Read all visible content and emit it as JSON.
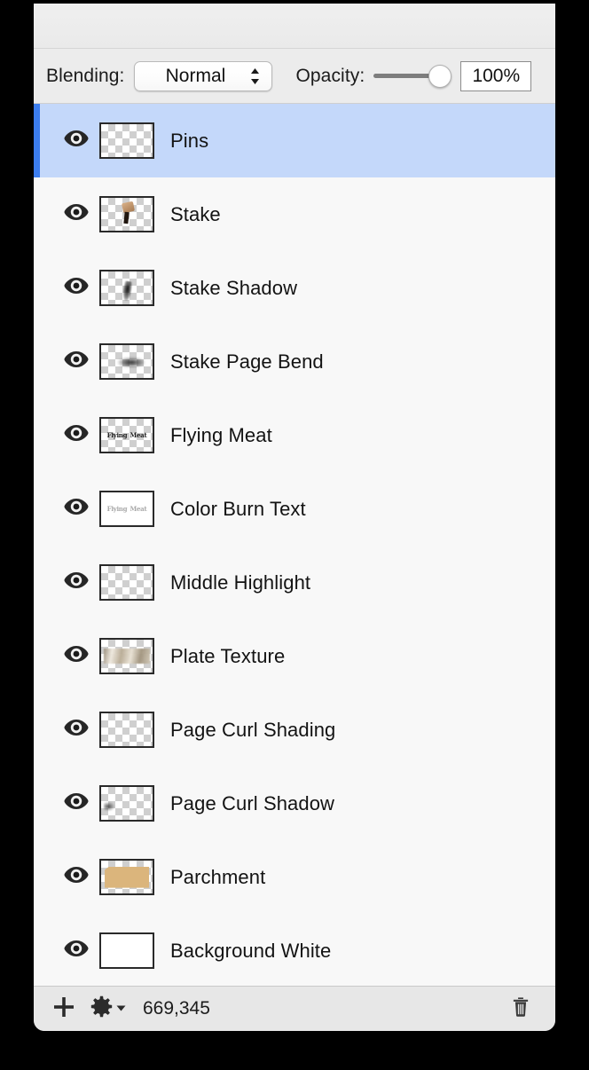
{
  "panel": {
    "title_bar": "",
    "blending": {
      "label": "Blending:",
      "mode_selected": "Normal",
      "mode_options": [
        "Normal"
      ]
    },
    "opacity": {
      "label": "Opacity:",
      "value": "100%",
      "slider_percent": 100
    }
  },
  "layers": [
    {
      "name": "Pins",
      "visible_icon": "eye-icon",
      "selected": true,
      "thumb": "checker"
    },
    {
      "name": "Stake",
      "visible_icon": "eye-icon",
      "selected": false,
      "thumb": "stake"
    },
    {
      "name": "Stake Shadow",
      "visible_icon": "eye-icon",
      "selected": false,
      "thumb": "shadow"
    },
    {
      "name": "Stake Page Bend",
      "visible_icon": "eye-icon",
      "selected": false,
      "thumb": "bend"
    },
    {
      "name": "Flying Meat",
      "visible_icon": "eye-icon",
      "selected": false,
      "thumb": "text-dark"
    },
    {
      "name": "Color Burn Text",
      "visible_icon": "eye-icon",
      "selected": false,
      "thumb": "text-faded"
    },
    {
      "name": "Middle Highlight",
      "visible_icon": "eye-icon",
      "selected": false,
      "thumb": "checker"
    },
    {
      "name": "Plate Texture",
      "visible_icon": "eye-icon",
      "selected": false,
      "thumb": "plate"
    },
    {
      "name": "Page Curl Shading",
      "visible_icon": "eye-icon",
      "selected": false,
      "thumb": "checker"
    },
    {
      "name": "Page Curl Shadow",
      "visible_icon": "eye-icon",
      "selected": false,
      "thumb": "curlshadow"
    },
    {
      "name": "Parchment",
      "visible_icon": "eye-icon",
      "selected": false,
      "thumb": "parchment"
    },
    {
      "name": "Background White",
      "visible_icon": "eye-icon",
      "selected": false,
      "thumb": "white"
    }
  ],
  "thumbnail_text": {
    "word1": "Flying",
    "word2": "Meat"
  },
  "bottom_bar": {
    "add_icon": "plus-icon",
    "settings_icon": "gear-icon",
    "settings_dropdown_icon": "triangle-down-icon",
    "count": "669,345",
    "delete_icon": "trash-icon"
  },
  "colors": {
    "selection_blue": "#c4d8fa",
    "selection_accent": "#3c7ef0",
    "panel_bg": "#f8f8f8",
    "toolbar_bg": "#ececec"
  }
}
